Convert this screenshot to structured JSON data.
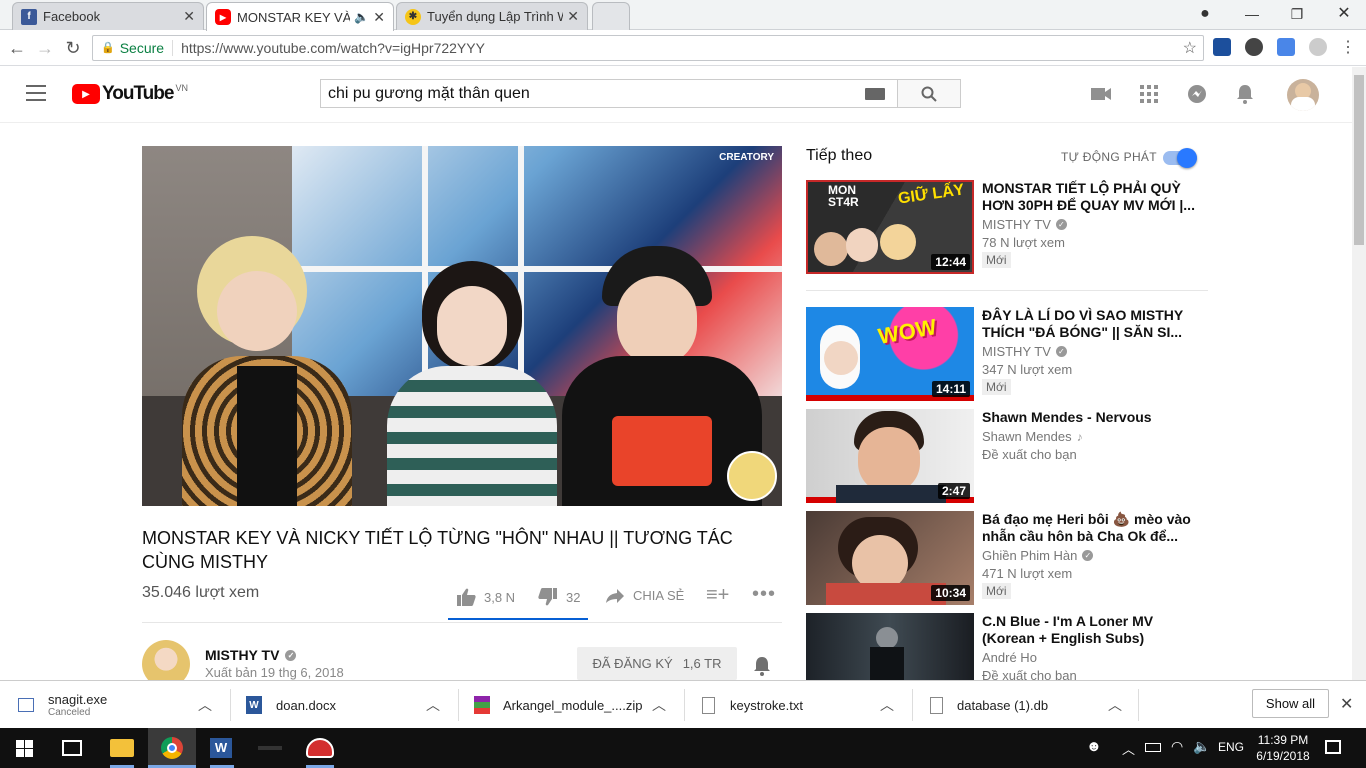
{
  "browser": {
    "tabs": [
      {
        "title": "Facebook",
        "active": false
      },
      {
        "title": "MONSTAR KEY VÀ NI",
        "active": true
      },
      {
        "title": "Tuyển dụng Lập Trình WE",
        "active": false
      }
    ],
    "secure_label": "Secure",
    "url": "https://www.youtube.com/watch?v=igHpr722YYY"
  },
  "youtube": {
    "logo_text": "YouTube",
    "logo_region": "VN",
    "search_query": "chi pu gương mặt thân quen",
    "watermark": "CREATORY",
    "video_title": "MONSTAR KEY VÀ NICKY TIẾT LỘ TỪNG \"HÔN\" NHAU || TƯƠNG TÁC CÙNG MISTHY",
    "views": "35.046 lượt xem",
    "likes": "3,8 N",
    "dislikes": "32",
    "share_label": "CHIA SẺ",
    "channel_name": "MISTHY TV",
    "published": "Xuất bản 19 thg 6, 2018",
    "subscribe_label": "ĐÃ ĐĂNG KÝ",
    "subscribers": "1,6 TR",
    "up_next_label": "Tiếp theo",
    "autoplay_label": "TỰ ĐỘNG PHÁT",
    "recommendations": [
      {
        "title": "MONSTAR TIẾT LỘ PHẢI QUỲ HƠN 30PH ĐỂ QUAY MV MỚI |...",
        "channel": "MISTHY TV",
        "meta": "78 N lượt xem",
        "badge": "Mới",
        "duration": "12:44"
      },
      {
        "title": "ĐÂY LÀ LÍ DO VÌ SAO MISTHY THÍCH \"ĐÁ BÓNG\" || SĂN SI...",
        "channel": "MISTHY TV",
        "meta": "347 N lượt xem",
        "badge": "Mới",
        "duration": "14:11"
      },
      {
        "title": "Shawn Mendes - Nervous",
        "channel": "Shawn Mendes",
        "meta": "Đề xuất cho bạn",
        "badge": "",
        "duration": "2:47"
      },
      {
        "title": "Bá đạo mẹ Heri bôi 💩 mèo vào nhẫn cầu hôn bà Cha Ok để...",
        "channel": "Ghiền Phim Hàn",
        "meta": "471 N lượt xem",
        "badge": "Mới",
        "duration": "10:34"
      },
      {
        "title": "C.N Blue - I'm A Loner MV (Korean + English Subs)",
        "channel": "André Ho",
        "meta": "Đề xuất cho bạn",
        "badge": "",
        "duration": ""
      }
    ]
  },
  "downloads": [
    {
      "name": "snagit.exe",
      "status": "Canceled"
    },
    {
      "name": "doan.docx",
      "status": ""
    },
    {
      "name": "Arkangel_module_....zip",
      "status": ""
    },
    {
      "name": "keystroke.txt",
      "status": ""
    },
    {
      "name": "database (1).db",
      "status": ""
    }
  ],
  "show_all_label": "Show all",
  "taskbar": {
    "lang": "ENG",
    "time": "11:39 PM",
    "date": "6/19/2018"
  },
  "colors": {
    "youtube_red": "#ff0000",
    "link_blue": "#065fd4",
    "toggle_blue": "#2979ff"
  }
}
